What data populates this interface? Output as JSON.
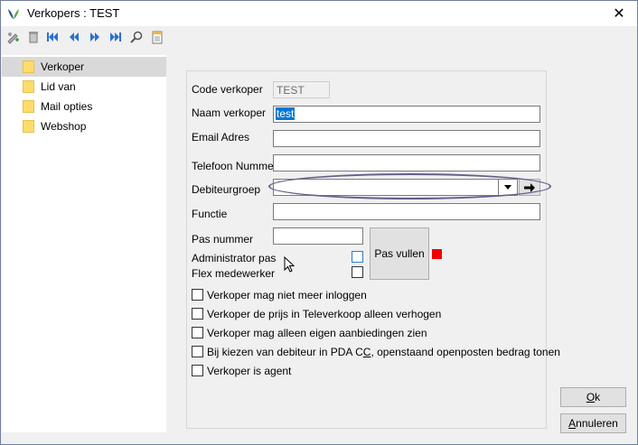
{
  "window": {
    "title": "Verkopers : TEST",
    "close_glyph": "✕"
  },
  "toolbar": {
    "buttons": [
      "add-user-icon",
      "delete-icon",
      "first-record-icon",
      "previous-record-icon",
      "next-record-icon",
      "last-record-icon",
      "search-icon",
      "notes-icon"
    ]
  },
  "sidebar": {
    "items": [
      {
        "label": "Verkoper",
        "selected": true
      },
      {
        "label": "Lid van",
        "selected": false
      },
      {
        "label": "Mail opties",
        "selected": false
      },
      {
        "label": "Webshop",
        "selected": false
      }
    ]
  },
  "form": {
    "code_label": "Code verkoper",
    "code_value": "TEST",
    "naam_label": "Naam verkoper",
    "naam_value": "test",
    "email_label": "Email Adres",
    "email_value": "",
    "telefoon_label": "Telefoon Nummer",
    "telefoon_value": "",
    "debiteurgroep_label": "Debiteurgroep",
    "debiteurgroep_value": "",
    "functie_label": "Functie",
    "functie_value": "",
    "pas_label": "Pas nummer",
    "pas_value": "",
    "pas_vullen_button": "Pas vullen",
    "admin_pas_label": "Administrator pas",
    "flex_label": "Flex medewerker"
  },
  "checkboxes": [
    {
      "label": "Verkoper mag niet meer inloggen",
      "checked": false
    },
    {
      "label": "Verkoper de prijs in Televerkoop alleen verhogen",
      "checked": false
    },
    {
      "label": "Verkoper mag alleen eigen aanbiedingen zien",
      "checked": false
    },
    {
      "label_pre": "Bij kiezen van debiteur in PDA C",
      "label_u": "C",
      "label_post": ", openstaand openposten bedrag tonen",
      "checked": false
    },
    {
      "label": "Verkoper is agent",
      "checked": false
    }
  ],
  "buttons": {
    "ok_u": "O",
    "ok_rest": "k",
    "annuleren_u": "A",
    "annuleren_rest": "nnuleren"
  },
  "colors": {
    "status_indicator": "#f00000",
    "selection": "#0078d7",
    "highlight_ellipse": "#6a5d8c"
  }
}
